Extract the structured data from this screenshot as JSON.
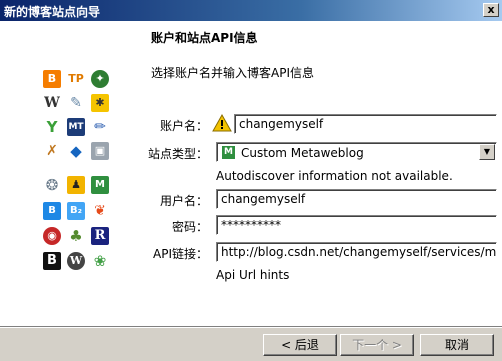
{
  "window": {
    "title": "新的博客站点向导",
    "close_label": "x"
  },
  "page": {
    "heading": "账户和站点API信息",
    "subtitle": "选择账户名并输入博客API信息"
  },
  "form": {
    "account_label": "账户名：",
    "account_value": "changemyself",
    "site_type_label": "站点类型：",
    "site_type_value": "Custom Metaweblog",
    "site_type_icon": "M",
    "autodiscover_message": "Autodiscover information not available.",
    "username_label": "用户名：",
    "username_value": "changemyself",
    "password_label": "密码：",
    "password_value": "**********",
    "api_label": "API链接：",
    "api_value": "http://blog.csdn.net/changemyself/services/metal",
    "api_hint": "Api Url hints"
  },
  "buttons": {
    "back": "< 后退",
    "next": "下一个 >",
    "cancel": "取消"
  },
  "icons": [
    [
      "blogger-icon",
      "tp-icon",
      "xanga-icon"
    ],
    [
      "wordpress-w-icon",
      "livejournal-icon",
      "ameblo-icon"
    ],
    [
      "vox-icon",
      "movabletype-icon",
      "blogsome-icon"
    ],
    [
      "blogharbor-icon",
      "blogcn-icon",
      "terapad-icon"
    ],
    [
      "lycos-icon",
      "tianya-icon",
      "metaweblog-icon"
    ],
    [
      "blogbus-icon",
      "blogbus2-icon",
      "windows-live-icon"
    ],
    [
      "sina-icon",
      "sohu-icon",
      "r-icon"
    ],
    [
      "b-icon",
      "wordpress-icon",
      "swirl-icon"
    ]
  ],
  "colors": {
    "titlebar_start": "#0a246a",
    "titlebar_end": "#a6caf0",
    "dialog_bg": "#d4d0c8",
    "warning": "#f2c200",
    "site_type_icon": "#2f8f3f"
  }
}
